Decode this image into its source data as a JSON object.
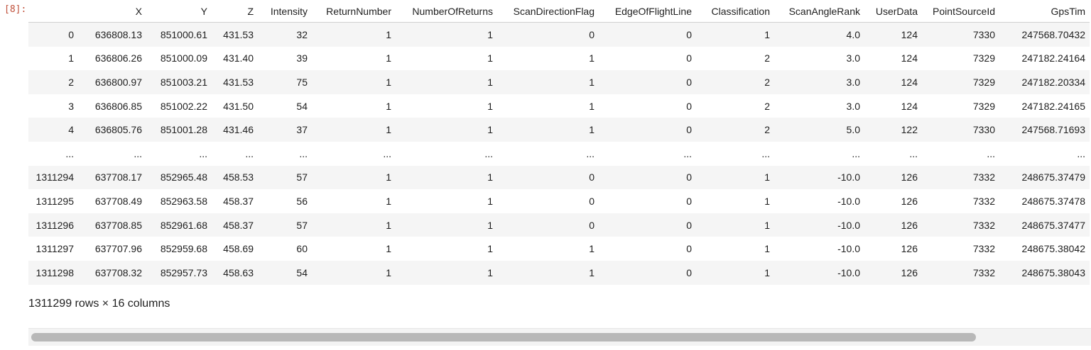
{
  "cell": {
    "prompt": "[8]:"
  },
  "dataframe": {
    "columns": [
      "",
      "X",
      "Y",
      "Z",
      "Intensity",
      "ReturnNumber",
      "NumberOfReturns",
      "ScanDirectionFlag",
      "EdgeOfFlightLine",
      "Classification",
      "ScanAngleRank",
      "UserData",
      "PointSourceId",
      "GpsTim"
    ],
    "rows": [
      [
        "0",
        "636808.13",
        "851000.61",
        "431.53",
        "32",
        "1",
        "1",
        "0",
        "0",
        "1",
        "4.0",
        "124",
        "7330",
        "247568.70432"
      ],
      [
        "1",
        "636806.26",
        "851000.09",
        "431.40",
        "39",
        "1",
        "1",
        "1",
        "0",
        "2",
        "3.0",
        "124",
        "7329",
        "247182.24164"
      ],
      [
        "2",
        "636800.97",
        "851003.21",
        "431.53",
        "75",
        "1",
        "1",
        "1",
        "0",
        "2",
        "3.0",
        "124",
        "7329",
        "247182.20334"
      ],
      [
        "3",
        "636806.85",
        "851002.22",
        "431.50",
        "54",
        "1",
        "1",
        "1",
        "0",
        "2",
        "3.0",
        "124",
        "7329",
        "247182.24165"
      ],
      [
        "4",
        "636805.76",
        "851001.28",
        "431.46",
        "37",
        "1",
        "1",
        "1",
        "0",
        "2",
        "5.0",
        "122",
        "7330",
        "247568.71693"
      ],
      [
        "...",
        "...",
        "...",
        "...",
        "...",
        "...",
        "...",
        "...",
        "...",
        "...",
        "...",
        "...",
        "...",
        "..."
      ],
      [
        "1311294",
        "637708.17",
        "852965.48",
        "458.53",
        "57",
        "1",
        "1",
        "0",
        "0",
        "1",
        "-10.0",
        "126",
        "7332",
        "248675.37479"
      ],
      [
        "1311295",
        "637708.49",
        "852963.58",
        "458.37",
        "56",
        "1",
        "1",
        "0",
        "0",
        "1",
        "-10.0",
        "126",
        "7332",
        "248675.37478"
      ],
      [
        "1311296",
        "637708.85",
        "852961.68",
        "458.37",
        "57",
        "1",
        "1",
        "0",
        "0",
        "1",
        "-10.0",
        "126",
        "7332",
        "248675.37477"
      ],
      [
        "1311297",
        "637707.96",
        "852959.68",
        "458.69",
        "60",
        "1",
        "1",
        "1",
        "0",
        "1",
        "-10.0",
        "126",
        "7332",
        "248675.38042"
      ],
      [
        "1311298",
        "637708.32",
        "852957.73",
        "458.63",
        "54",
        "1",
        "1",
        "1",
        "0",
        "1",
        "-10.0",
        "126",
        "7332",
        "248675.38043"
      ]
    ],
    "shape_text": "1311299 rows × 16 columns"
  }
}
